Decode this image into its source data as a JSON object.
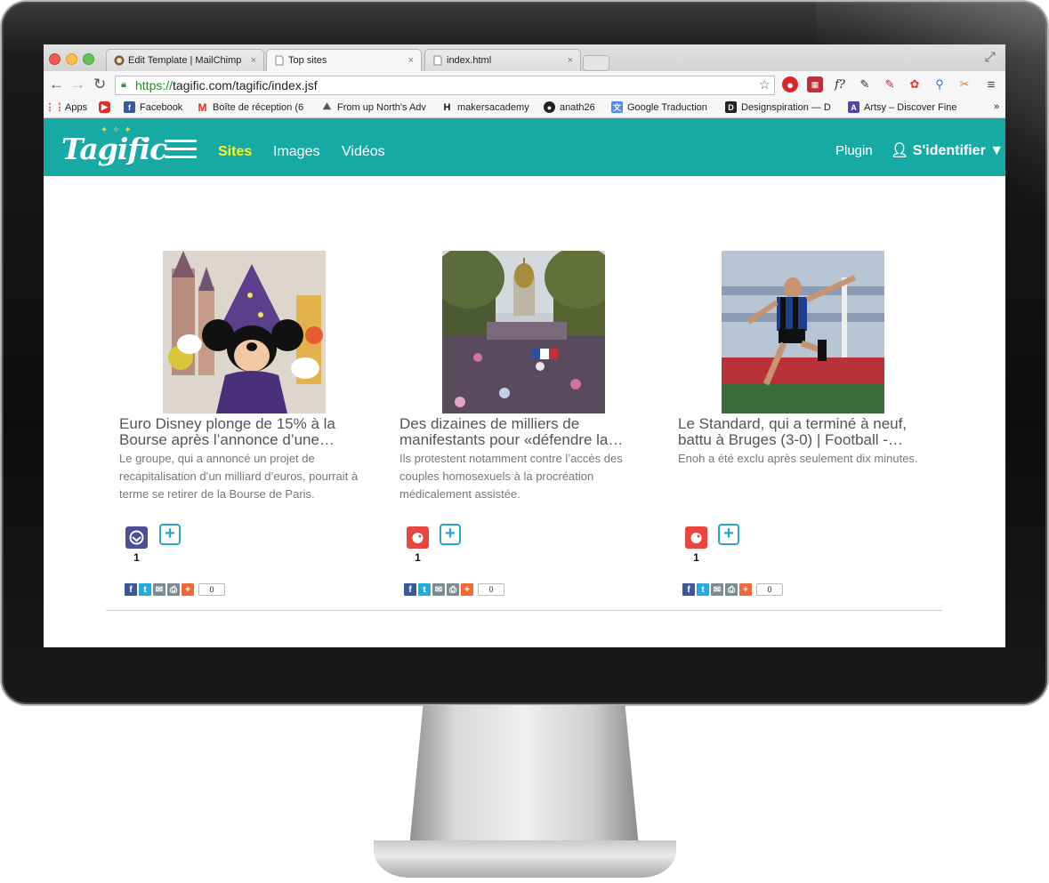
{
  "browser": {
    "tabs": [
      {
        "label": "Edit Template | MailChimp",
        "close": "×"
      },
      {
        "label": "Top sites",
        "close": "×"
      },
      {
        "label": "index.html",
        "close": "×"
      }
    ],
    "url_scheme": "https://",
    "url_rest": "tagific.com/tagific/index.jsf",
    "bookmarks": [
      {
        "label": "Apps"
      },
      {
        "label": ""
      },
      {
        "label": "Facebook"
      },
      {
        "label": "Boîte de réception (6"
      },
      {
        "label": "From up North's Adv"
      },
      {
        "label": "makersacademy"
      },
      {
        "label": "anath26"
      },
      {
        "label": "Google Traduction"
      },
      {
        "label": "Designspiration — D"
      },
      {
        "label": "Artsy – Discover Fine"
      }
    ],
    "bookmarks_more": "»"
  },
  "site": {
    "logo": "Tagific",
    "nav": [
      "Sites",
      "Images",
      "Vidéos"
    ],
    "plugin": "Plugin",
    "login": "S'identifier ▼",
    "brand_color": "#17a9a4",
    "active_nav_color": "#f6f52a"
  },
  "cards": [
    {
      "title": "Euro Disney plonge de 15% à la Bourse après l’annonce d’une…",
      "description": "Le groupe, qui a annoncé un projet de recapitalisation d’un milliard d’euros, pourrait à terme se retirer de la Bourse de Paris.",
      "count": "1",
      "share_count": "0",
      "source_icon_color": "#4b4f9a"
    },
    {
      "title": "Des dizaines de milliers de manifestants pour «défendre la…",
      "description": "Ils protestent notamment contre l’accès des couples homosexuels à la procréation médicalement assistée.",
      "count": "1",
      "share_count": "0",
      "source_icon_color": "#e8463e"
    },
    {
      "title": "Le Standard, qui a terminé à neuf, battu à Bruges (3-0) | Football -…",
      "description": "Enoh a été exclu après seulement dix minutes.",
      "count": "1",
      "share_count": "0",
      "source_icon_color": "#e8463e"
    }
  ]
}
